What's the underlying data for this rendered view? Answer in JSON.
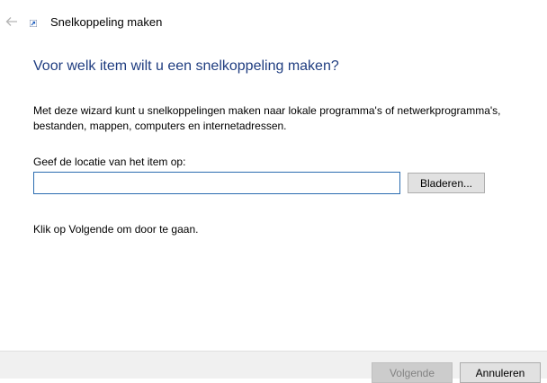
{
  "window": {
    "title": "Snelkoppeling maken",
    "back_icon": "arrow-left-icon",
    "title_icon": "shortcut-icon"
  },
  "main": {
    "heading": "Voor welk item wilt u een snelkoppeling maken?",
    "description": "Met deze wizard kunt u snelkoppelingen maken naar lokale programma's of netwerkprogramma's, bestanden, mappen, computers en internetadressen.",
    "location_label": "Geef de locatie van het item op:",
    "location_value": "",
    "browse_label": "Bladeren...",
    "hint": "Klik op Volgende om door te gaan."
  },
  "footer": {
    "next_label": "Volgende",
    "cancel_label": "Annuleren"
  },
  "colors": {
    "heading": "#1f3d80",
    "input_border": "#2b6cb0",
    "footer_background": "#f0f0f0",
    "disabled_text": "#838383"
  }
}
